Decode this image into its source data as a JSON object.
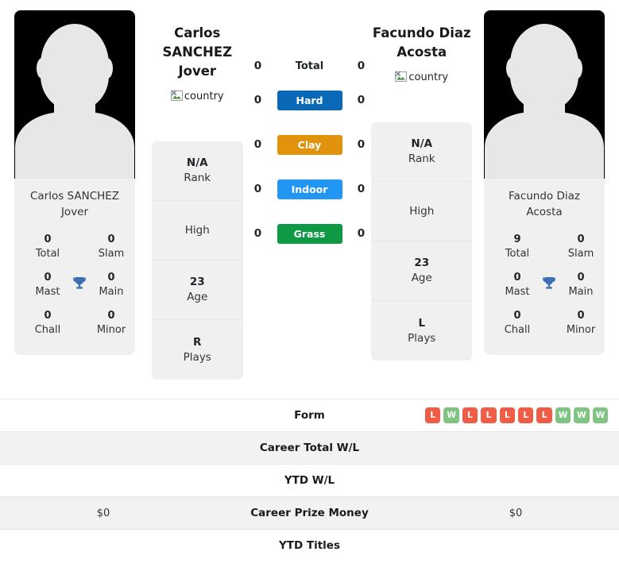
{
  "players": {
    "left": {
      "display_name_line1": "Carlos",
      "display_name_line2": "SANCHEZ Jover",
      "card_name": "Carlos SANCHEZ Jover",
      "country_alt": "country",
      "titles": {
        "total_value": "0",
        "total_label": "Total",
        "slam_value": "0",
        "slam_label": "Slam",
        "mast_value": "0",
        "mast_label": "Mast",
        "main_value": "0",
        "main_label": "Main",
        "chall_value": "0",
        "chall_label": "Chall",
        "minor_value": "0",
        "minor_label": "Minor"
      },
      "stats": {
        "rank_value": "N/A",
        "rank_label": "Rank",
        "high_value": "",
        "high_label": "High",
        "age_value": "23",
        "age_label": "Age",
        "plays_value": "R",
        "plays_label": "Plays"
      },
      "surface_counts": {
        "total": "0",
        "hard": "0",
        "clay": "0",
        "indoor": "0",
        "grass": "0"
      },
      "table_values": {
        "form": [],
        "career_total_wl": "",
        "ytd_wl": "",
        "career_prize_money": "$0",
        "ytd_titles": ""
      }
    },
    "right": {
      "display_name_line1": "Facundo Diaz",
      "display_name_line2": "Acosta",
      "card_name": "Facundo Diaz Acosta",
      "country_alt": "country",
      "titles": {
        "total_value": "9",
        "total_label": "Total",
        "slam_value": "0",
        "slam_label": "Slam",
        "mast_value": "0",
        "mast_label": "Mast",
        "main_value": "0",
        "main_label": "Main",
        "chall_value": "0",
        "chall_label": "Chall",
        "minor_value": "0",
        "minor_label": "Minor"
      },
      "stats": {
        "rank_value": "N/A",
        "rank_label": "Rank",
        "high_value": "",
        "high_label": "High",
        "age_value": "23",
        "age_label": "Age",
        "plays_value": "L",
        "plays_label": "Plays"
      },
      "surface_counts": {
        "total": "0",
        "hard": "0",
        "clay": "0",
        "indoor": "0",
        "grass": "0"
      },
      "table_values": {
        "form": [
          "L",
          "W",
          "L",
          "L",
          "L",
          "L",
          "L",
          "W",
          "W",
          "W"
        ],
        "career_total_wl": "",
        "ytd_wl": "",
        "career_prize_money": "$0",
        "ytd_titles": ""
      }
    }
  },
  "surfaces": [
    {
      "key": "total",
      "label": "Total",
      "style": "plain",
      "color": ""
    },
    {
      "key": "hard",
      "label": "Hard",
      "style": "pill",
      "color": "#0a69b7"
    },
    {
      "key": "clay",
      "label": "Clay",
      "style": "pill",
      "color": "#e1930e"
    },
    {
      "key": "indoor",
      "label": "Indoor",
      "style": "pill",
      "color": "#2196f3"
    },
    {
      "key": "grass",
      "label": "Grass",
      "style": "pill",
      "color": "#109944"
    }
  ],
  "table_rows": [
    {
      "key": "form",
      "label": "Form",
      "shaded": false
    },
    {
      "key": "career_total_wl",
      "label": "Career Total W/L",
      "shaded": true
    },
    {
      "key": "ytd_wl",
      "label": "YTD W/L",
      "shaded": false
    },
    {
      "key": "career_prize_money",
      "label": "Career Prize Money",
      "shaded": true
    },
    {
      "key": "ytd_titles",
      "label": "YTD Titles",
      "shaded": false
    }
  ],
  "icons": {
    "trophy": "🏆"
  },
  "colors": {
    "form_win": "#7fc482",
    "form_loss": "#ef5d46",
    "trophy": "#3b6fb5",
    "card_bg": "#f0f0f0",
    "row_shaded": "#f2f2f2"
  }
}
